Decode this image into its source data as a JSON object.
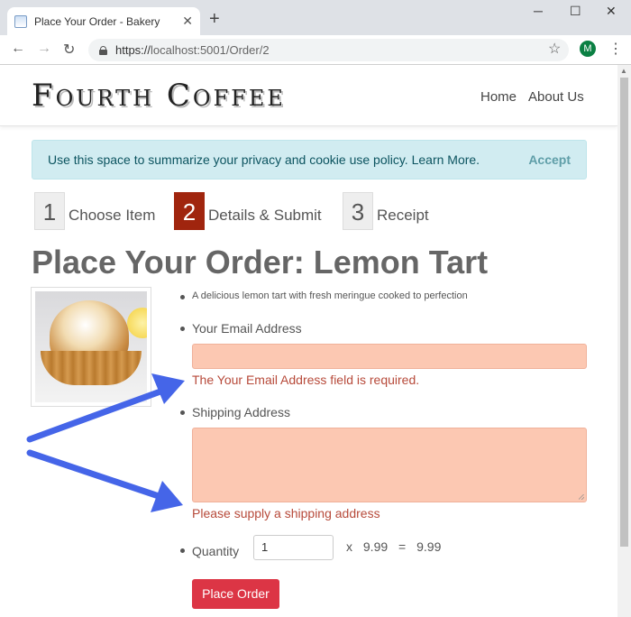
{
  "browser": {
    "tab_title": "Place Your Order - Bakery",
    "tab_close": "✕",
    "new_tab": "+",
    "window_controls": [
      "─",
      "☐",
      "✕"
    ],
    "back": "←",
    "forward": "→",
    "reload": "↻",
    "url_scheme": "https://",
    "url_rest": "localhost:5001/Order/2",
    "star": "☆",
    "profile_initial": "M",
    "menu": "⋮"
  },
  "site": {
    "logo": "Fourth Coffee",
    "nav": [
      "Home",
      "About Us"
    ]
  },
  "cookie": {
    "text": "Use this space to summarize your privacy and cookie use policy. Learn More.",
    "accept": "Accept"
  },
  "steps": [
    {
      "num": "1",
      "label": "Choose Item",
      "active": false
    },
    {
      "num": "2",
      "label": "Details & Submit",
      "active": true
    },
    {
      "num": "3",
      "label": "Receipt",
      "active": false
    }
  ],
  "page": {
    "heading": "Place Your Order: Lemon Tart"
  },
  "product": {
    "description": "A delicious lemon tart with fresh meringue cooked to perfection"
  },
  "form": {
    "email_label": "Your Email Address",
    "email_value": "",
    "email_error": "The Your Email Address field is required.",
    "shipping_label": "Shipping Address",
    "shipping_value": "",
    "shipping_error": "Please supply a shipping address",
    "quantity_label": "Quantity",
    "quantity_value": "1",
    "times": "x",
    "unit_price": "9.99",
    "equals": "=",
    "total": "9.99",
    "submit": "Place Order"
  },
  "colors": {
    "error_field": "#fcc8b2",
    "error_text": "#b74a3a",
    "active_step": "#a0250e",
    "button": "#dc3545",
    "cookie_bg": "#d1ecf1",
    "annotation_arrow": "#4565e8"
  }
}
